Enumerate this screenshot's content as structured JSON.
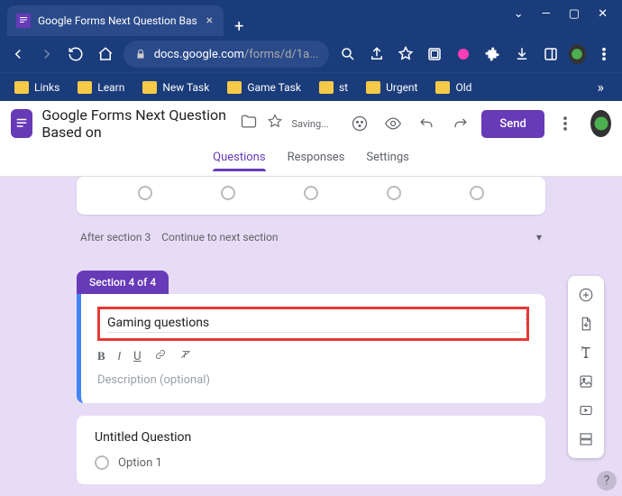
{
  "browser": {
    "tab_title": "Google Forms Next Question Bas",
    "url_display": "docs.google.com/forms/d/1a...",
    "url_host": "docs.google.com",
    "url_path": "/forms/d/1a..."
  },
  "bookmarks": [
    {
      "label": "Links"
    },
    {
      "label": "Learn"
    },
    {
      "label": "New Task"
    },
    {
      "label": "Game Task"
    },
    {
      "label": "st"
    },
    {
      "label": "Urgent"
    },
    {
      "label": "Old"
    }
  ],
  "forms_header": {
    "title": "Google Forms Next Question Based on",
    "status": "Saving...",
    "send_label": "Send"
  },
  "tabs": {
    "questions": "Questions",
    "responses": "Responses",
    "settings": "Settings"
  },
  "section_nav": {
    "after_label": "After section 3",
    "action": "Continue to next section"
  },
  "section": {
    "badge": "Section 4 of 4",
    "title_value": "Gaming questions",
    "desc_placeholder": "Description (optional)"
  },
  "question": {
    "title": "Untitled Question",
    "option1": "Option 1"
  },
  "format": {
    "bold": "B",
    "italic": "I",
    "underline": "U"
  }
}
